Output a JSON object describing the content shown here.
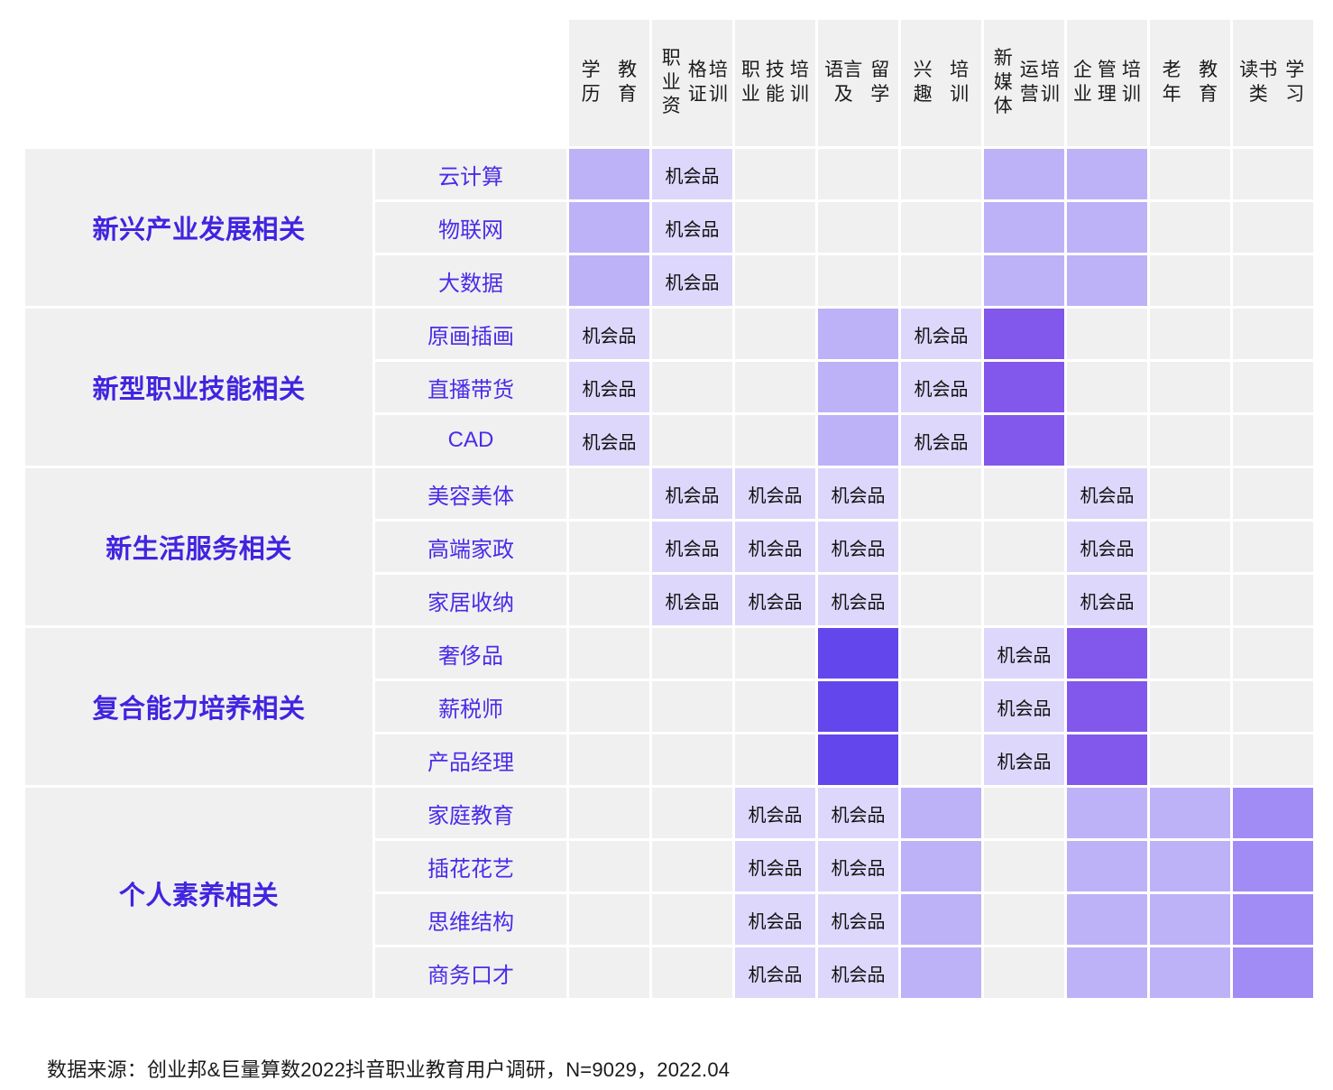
{
  "legend": {
    "chance_label": "机会品",
    "colors": {
      "empty": "#f0f0f0",
      "chance": "#ddd7fb",
      "level1": "#bdb2f7",
      "level2": "#a18cf5",
      "level3": "#8257eb",
      "level4": "#6347ec",
      "group_text": "#4124E0",
      "row_text": "#4B2BE8"
    }
  },
  "columns": [
    {
      "id": "col-xueli-jiaoyu",
      "lines": [
        "学历",
        "教育"
      ]
    },
    {
      "id": "col-zhiye-zigezheng",
      "lines": [
        "职业资",
        "格证",
        "培训"
      ]
    },
    {
      "id": "col-zhiye-jineng",
      "lines": [
        "职业",
        "技能",
        "培训"
      ]
    },
    {
      "id": "col-yuyan-liuxue",
      "lines": [
        "语言及",
        "留学"
      ]
    },
    {
      "id": "col-xingqu-peixun",
      "lines": [
        "兴趣",
        "培训"
      ]
    },
    {
      "id": "col-xinmeiti-yunying",
      "lines": [
        "新媒体",
        "运营",
        "培训"
      ]
    },
    {
      "id": "col-qiye-guanli",
      "lines": [
        "企业",
        "管理",
        "培训"
      ]
    },
    {
      "id": "col-laonian-jiaoyu",
      "lines": [
        "老年",
        "教育"
      ]
    },
    {
      "id": "col-dushulei-xuexi",
      "lines": [
        "读书类",
        "学习"
      ]
    }
  ],
  "groups": [
    {
      "id": "group-xinxing-chanye",
      "label": "新兴产业发展相关",
      "rows": [
        {
          "id": "row-yunjisuan",
          "label": "云计算",
          "cells": [
            {
              "level": "level1",
              "text": ""
            },
            {
              "level": "chance",
              "text": "机会品"
            },
            {
              "level": "empty",
              "text": ""
            },
            {
              "level": "empty",
              "text": ""
            },
            {
              "level": "empty",
              "text": ""
            },
            {
              "level": "level1",
              "text": ""
            },
            {
              "level": "level1",
              "text": ""
            },
            {
              "level": "empty",
              "text": ""
            },
            {
              "level": "empty",
              "text": ""
            }
          ]
        },
        {
          "id": "row-wulianwang",
          "label": "物联网",
          "cells": [
            {
              "level": "level1",
              "text": ""
            },
            {
              "level": "chance",
              "text": "机会品"
            },
            {
              "level": "empty",
              "text": ""
            },
            {
              "level": "empty",
              "text": ""
            },
            {
              "level": "empty",
              "text": ""
            },
            {
              "level": "level1",
              "text": ""
            },
            {
              "level": "level1",
              "text": ""
            },
            {
              "level": "empty",
              "text": ""
            },
            {
              "level": "empty",
              "text": ""
            }
          ]
        },
        {
          "id": "row-dashuju",
          "label": "大数据",
          "cells": [
            {
              "level": "level1",
              "text": ""
            },
            {
              "level": "chance",
              "text": "机会品"
            },
            {
              "level": "empty",
              "text": ""
            },
            {
              "level": "empty",
              "text": ""
            },
            {
              "level": "empty",
              "text": ""
            },
            {
              "level": "level1",
              "text": ""
            },
            {
              "level": "level1",
              "text": ""
            },
            {
              "level": "empty",
              "text": ""
            },
            {
              "level": "empty",
              "text": ""
            }
          ]
        }
      ]
    },
    {
      "id": "group-xinxing-zhiye-jineng",
      "label": "新型职业技能相关",
      "rows": [
        {
          "id": "row-yuanhua-chahua",
          "label": "原画插画",
          "cells": [
            {
              "level": "chance",
              "text": "机会品"
            },
            {
              "level": "empty",
              "text": ""
            },
            {
              "level": "empty",
              "text": ""
            },
            {
              "level": "level1",
              "text": ""
            },
            {
              "level": "chance",
              "text": "机会品"
            },
            {
              "level": "level3",
              "text": ""
            },
            {
              "level": "empty",
              "text": ""
            },
            {
              "level": "empty",
              "text": ""
            },
            {
              "level": "empty",
              "text": ""
            }
          ]
        },
        {
          "id": "row-zhibo-daihuo",
          "label": "直播带货",
          "cells": [
            {
              "level": "chance",
              "text": "机会品"
            },
            {
              "level": "empty",
              "text": ""
            },
            {
              "level": "empty",
              "text": ""
            },
            {
              "level": "level1",
              "text": ""
            },
            {
              "level": "chance",
              "text": "机会品"
            },
            {
              "level": "level3",
              "text": ""
            },
            {
              "level": "empty",
              "text": ""
            },
            {
              "level": "empty",
              "text": ""
            },
            {
              "level": "empty",
              "text": ""
            }
          ]
        },
        {
          "id": "row-cad",
          "label": "CAD",
          "cells": [
            {
              "level": "chance",
              "text": "机会品"
            },
            {
              "level": "empty",
              "text": ""
            },
            {
              "level": "empty",
              "text": ""
            },
            {
              "level": "level1",
              "text": ""
            },
            {
              "level": "chance",
              "text": "机会品"
            },
            {
              "level": "level3",
              "text": ""
            },
            {
              "level": "empty",
              "text": ""
            },
            {
              "level": "empty",
              "text": ""
            },
            {
              "level": "empty",
              "text": ""
            }
          ]
        }
      ]
    },
    {
      "id": "group-xin-shenghuo-fuwu",
      "label": "新生活服务相关",
      "rows": [
        {
          "id": "row-meirong-meiti",
          "label": "美容美体",
          "cells": [
            {
              "level": "empty",
              "text": ""
            },
            {
              "level": "chance",
              "text": "机会品"
            },
            {
              "level": "chance",
              "text": "机会品"
            },
            {
              "level": "chance",
              "text": "机会品"
            },
            {
              "level": "empty",
              "text": ""
            },
            {
              "level": "empty",
              "text": ""
            },
            {
              "level": "chance",
              "text": "机会品"
            },
            {
              "level": "empty",
              "text": ""
            },
            {
              "level": "empty",
              "text": ""
            }
          ]
        },
        {
          "id": "row-gaoduan-jiazheng",
          "label": "高端家政",
          "cells": [
            {
              "level": "empty",
              "text": ""
            },
            {
              "level": "chance",
              "text": "机会品"
            },
            {
              "level": "chance",
              "text": "机会品"
            },
            {
              "level": "chance",
              "text": "机会品"
            },
            {
              "level": "empty",
              "text": ""
            },
            {
              "level": "empty",
              "text": ""
            },
            {
              "level": "chance",
              "text": "机会品"
            },
            {
              "level": "empty",
              "text": ""
            },
            {
              "level": "empty",
              "text": ""
            }
          ]
        },
        {
          "id": "row-jiaju-shouna",
          "label": "家居收纳",
          "cells": [
            {
              "level": "empty",
              "text": ""
            },
            {
              "level": "chance",
              "text": "机会品"
            },
            {
              "level": "chance",
              "text": "机会品"
            },
            {
              "level": "chance",
              "text": "机会品"
            },
            {
              "level": "empty",
              "text": ""
            },
            {
              "level": "empty",
              "text": ""
            },
            {
              "level": "chance",
              "text": "机会品"
            },
            {
              "level": "empty",
              "text": ""
            },
            {
              "level": "empty",
              "text": ""
            }
          ]
        }
      ]
    },
    {
      "id": "group-fuhe-nengli",
      "label": "复合能力培养相关",
      "rows": [
        {
          "id": "row-shechipin",
          "label": "奢侈品",
          "cells": [
            {
              "level": "empty",
              "text": ""
            },
            {
              "level": "empty",
              "text": ""
            },
            {
              "level": "empty",
              "text": ""
            },
            {
              "level": "level4",
              "text": ""
            },
            {
              "level": "empty",
              "text": ""
            },
            {
              "level": "chance",
              "text": "机会品"
            },
            {
              "level": "level3",
              "text": ""
            },
            {
              "level": "empty",
              "text": ""
            },
            {
              "level": "empty",
              "text": ""
            }
          ]
        },
        {
          "id": "row-xinshuishi",
          "label": "薪税师",
          "cells": [
            {
              "level": "empty",
              "text": ""
            },
            {
              "level": "empty",
              "text": ""
            },
            {
              "level": "empty",
              "text": ""
            },
            {
              "level": "level4",
              "text": ""
            },
            {
              "level": "empty",
              "text": ""
            },
            {
              "level": "chance",
              "text": "机会品"
            },
            {
              "level": "level3",
              "text": ""
            },
            {
              "level": "empty",
              "text": ""
            },
            {
              "level": "empty",
              "text": ""
            }
          ]
        },
        {
          "id": "row-chanpin-jingli",
          "label": "产品经理",
          "cells": [
            {
              "level": "empty",
              "text": ""
            },
            {
              "level": "empty",
              "text": ""
            },
            {
              "level": "empty",
              "text": ""
            },
            {
              "level": "level4",
              "text": ""
            },
            {
              "level": "empty",
              "text": ""
            },
            {
              "level": "chance",
              "text": "机会品"
            },
            {
              "level": "level3",
              "text": ""
            },
            {
              "level": "empty",
              "text": ""
            },
            {
              "level": "empty",
              "text": ""
            }
          ]
        }
      ]
    },
    {
      "id": "group-geren-suyang",
      "label": "个人素养相关",
      "rows": [
        {
          "id": "row-jiating-jiaoyu",
          "label": "家庭教育",
          "cells": [
            {
              "level": "empty",
              "text": ""
            },
            {
              "level": "empty",
              "text": ""
            },
            {
              "level": "chance",
              "text": "机会品"
            },
            {
              "level": "chance",
              "text": "机会品"
            },
            {
              "level": "level1",
              "text": ""
            },
            {
              "level": "empty",
              "text": ""
            },
            {
              "level": "level1",
              "text": ""
            },
            {
              "level": "level1",
              "text": ""
            },
            {
              "level": "level2",
              "text": ""
            }
          ]
        },
        {
          "id": "row-chahua-huayi",
          "label": "插花花艺",
          "cells": [
            {
              "level": "empty",
              "text": ""
            },
            {
              "level": "empty",
              "text": ""
            },
            {
              "level": "chance",
              "text": "机会品"
            },
            {
              "level": "chance",
              "text": "机会品"
            },
            {
              "level": "level1",
              "text": ""
            },
            {
              "level": "empty",
              "text": ""
            },
            {
              "level": "level1",
              "text": ""
            },
            {
              "level": "level1",
              "text": ""
            },
            {
              "level": "level2",
              "text": ""
            }
          ]
        },
        {
          "id": "row-siwei-jiegou",
          "label": "思维结构",
          "cells": [
            {
              "level": "empty",
              "text": ""
            },
            {
              "level": "empty",
              "text": ""
            },
            {
              "level": "chance",
              "text": "机会品"
            },
            {
              "level": "chance",
              "text": "机会品"
            },
            {
              "level": "level1",
              "text": ""
            },
            {
              "level": "empty",
              "text": ""
            },
            {
              "level": "level1",
              "text": ""
            },
            {
              "level": "level1",
              "text": ""
            },
            {
              "level": "level2",
              "text": ""
            }
          ]
        },
        {
          "id": "row-shangwu-koucai",
          "label": "商务口才",
          "cells": [
            {
              "level": "empty",
              "text": ""
            },
            {
              "level": "empty",
              "text": ""
            },
            {
              "level": "chance",
              "text": "机会品"
            },
            {
              "level": "chance",
              "text": "机会品"
            },
            {
              "level": "level1",
              "text": ""
            },
            {
              "level": "empty",
              "text": ""
            },
            {
              "level": "level1",
              "text": ""
            },
            {
              "level": "level1",
              "text": ""
            },
            {
              "level": "level2",
              "text": ""
            }
          ]
        }
      ]
    }
  ],
  "footer": {
    "source_note": "数据来源：创业邦&巨量算数2022抖音职业教育用户调研，N=9029，2022.04"
  }
}
